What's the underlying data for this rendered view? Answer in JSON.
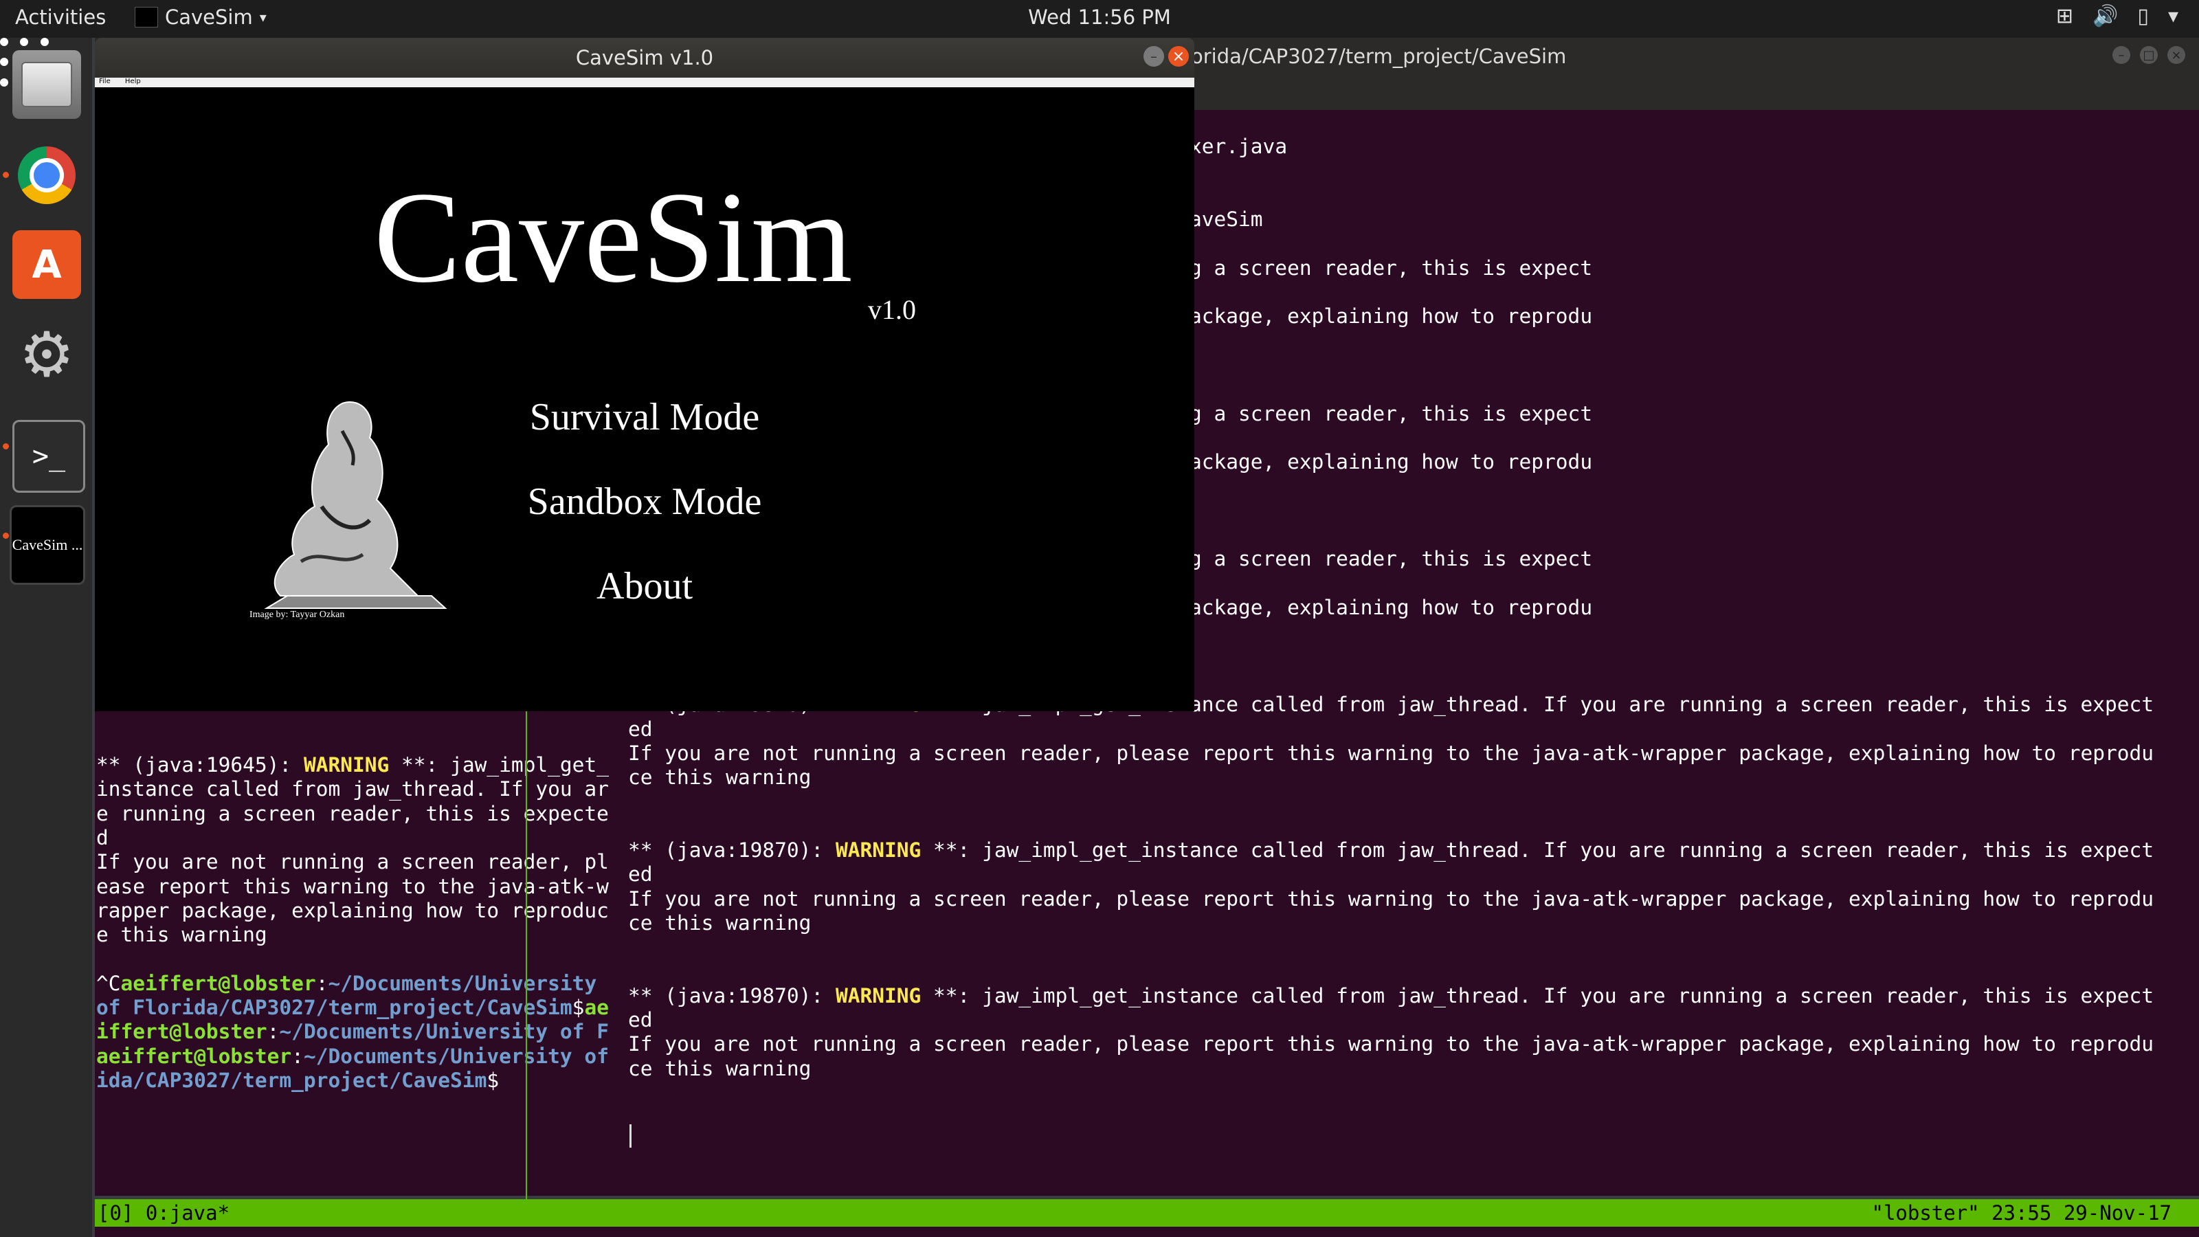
{
  "topbar": {
    "activities": "Activities",
    "app_name": "CaveSim",
    "clock": "Wed 11:56 PM"
  },
  "dock": {
    "items": [
      "files",
      "chrome",
      "software",
      "settings",
      "terminal",
      "cavesim"
    ],
    "cavesim_label": "CaveSim ..."
  },
  "terminal": {
    "title": "orida/CAP3027/term_project/CaveSim",
    "right_pane": [
      [
        {
          "t": "rida/CAP3027/term_project/CaveSim",
          "c": "path"
        },
        {
          "t": "$ vi makefile"
        }
      ],
      [
        {
          "t": "rida/CAP3027/term_project/CaveSim",
          "c": "path"
        },
        {
          "t": "$ vi Multiplexer.java"
        }
      ],
      [
        {
          "t": "rida/CAP3027/term_project/CaveSim",
          "c": "path"
        },
        {
          "t": "$ make"
        }
      ],
      [],
      [
        {
          "t": "f Florida/CAP3027/term_project/CaveSim",
          "c": "path"
        },
        {
          "t": "$ java CaveSim"
        }
      ],
      [],
      [
        {
          "t": "ance called from jaw_thread. If you are running a screen reader, this is expect"
        }
      ],
      [],
      [
        {
          "t": " report this warning to the java-atk-wrapper package, explaining how to reprodu"
        }
      ],
      [],
      [],
      [],
      [
        {
          "t": "ance called from jaw_thread. If you are running a screen reader, this is expect"
        }
      ],
      [],
      [
        {
          "t": " report this warning to the java-atk-wrapper package, explaining how to reprodu"
        }
      ],
      [],
      [],
      [],
      [
        {
          "t": "ance called from jaw_thread. If you are running a screen reader, this is expect"
        }
      ],
      [],
      [
        {
          "t": " report this warning to the java-atk-wrapper package, explaining how to reprodu"
        }
      ],
      [],
      [],
      [],
      [
        {
          "t": "** (java:19870): "
        },
        {
          "t": "WARNING",
          "c": "warn"
        },
        {
          "t": " **: jaw_impl_get_instance called from jaw_thread. If you are running a screen reader, this is expect"
        }
      ],
      [
        {
          "t": "ed"
        }
      ],
      [
        {
          "t": "If you are not running a screen reader, please report this warning to the java-atk-wrapper package, explaining how to reprodu"
        }
      ],
      [
        {
          "t": "ce this warning"
        }
      ],
      [],
      [],
      [
        {
          "t": "** (java:19870): "
        },
        {
          "t": "WARNING",
          "c": "warn"
        },
        {
          "t": " **: jaw_impl_get_instance called from jaw_thread. If you are running a screen reader, this is expect"
        }
      ],
      [
        {
          "t": "ed"
        }
      ],
      [
        {
          "t": "If you are not running a screen reader, please report this warning to the java-atk-wrapper package, explaining how to reprodu"
        }
      ],
      [
        {
          "t": "ce this warning"
        }
      ],
      [],
      [],
      [
        {
          "t": "** (java:19870): "
        },
        {
          "t": "WARNING",
          "c": "warn"
        },
        {
          "t": " **: jaw_impl_get_instance called from jaw_thread. If you are running a screen reader, this is expect"
        }
      ],
      [
        {
          "t": "ed"
        }
      ],
      [
        {
          "t": "If you are not running a screen reader, please report this warning to the java-atk-wrapper package, explaining how to reprodu"
        }
      ],
      [
        {
          "t": "ce this warning"
        }
      ]
    ],
    "left_pane": [
      [
        {
          "t": "** (java:19645): "
        },
        {
          "t": "WARNING",
          "c": "warn"
        },
        {
          "t": " **: jaw_impl_get_"
        }
      ],
      [
        {
          "t": "instance called from jaw_thread. If you ar"
        }
      ],
      [
        {
          "t": "e running a screen reader, this is expecte"
        }
      ],
      [
        {
          "t": "d"
        }
      ],
      [
        {
          "t": "If you are not running a screen reader, pl"
        }
      ],
      [
        {
          "t": "ease report this warning to the java-atk-w"
        }
      ],
      [
        {
          "t": "rapper package, explaining how to reproduc"
        }
      ],
      [
        {
          "t": "e this warning"
        }
      ],
      [],
      [
        {
          "t": "^C"
        },
        {
          "t": "aeiffert@lobster",
          "c": "user"
        },
        {
          "t": ":"
        },
        {
          "t": "~/Documents/University",
          "c": "path"
        }
      ],
      [
        {
          "t": "of Florida/CAP3027/term_project/CaveSim",
          "c": "path"
        },
        {
          "t": "$"
        },
        {
          "t": "ae",
          "c": "user"
        }
      ],
      [
        {
          "t": "iffert@lobster",
          "c": "user"
        },
        {
          "t": ":"
        },
        {
          "t": "~/Documents/University of F",
          "c": "path"
        }
      ],
      [
        {
          "t": "aeiffert@lobster",
          "c": "user"
        },
        {
          "t": ":"
        },
        {
          "t": "~/Documents/University of ",
          "c": "path"
        }
      ],
      [
        {
          "t": "ida/CAP3027/term_project/CaveSim",
          "c": "path"
        },
        {
          "t": "$"
        }
      ]
    ],
    "status_left": "[0] 0:java*",
    "status_right": "\"lobster\" 23:55 29-Nov-17"
  },
  "cavesim": {
    "window_title": "CaveSim v1.0",
    "menu": [
      "File",
      "Help"
    ],
    "logo": "CaveSim",
    "version": "v1.0",
    "options": [
      "Survival Mode",
      "Sandbox Mode",
      "About"
    ],
    "image_credit": "Image by: Tayyar Ozkan"
  }
}
